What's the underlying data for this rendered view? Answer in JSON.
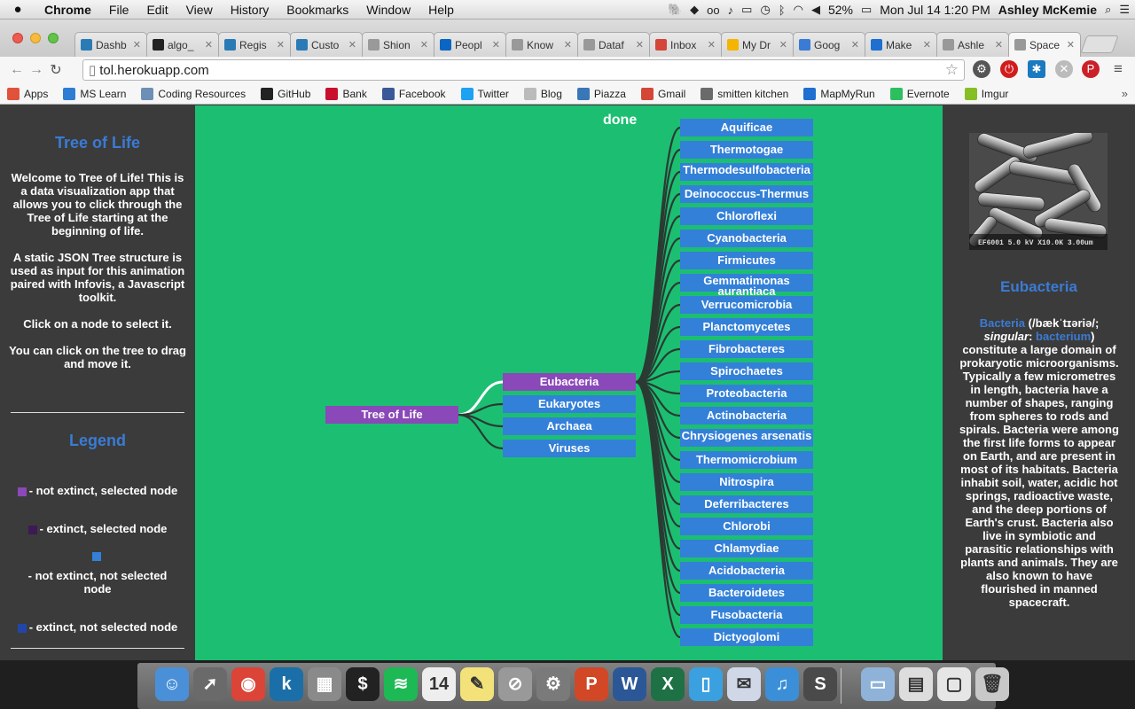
{
  "menubar": {
    "apple_icon": "apple-logo-icon",
    "app_name": "Chrome",
    "items": [
      "File",
      "Edit",
      "View",
      "History",
      "Bookmarks",
      "Window",
      "Help"
    ],
    "battery": "52%",
    "clock": "Mon Jul 14  1:20 PM",
    "user": "Ashley McKemie"
  },
  "tabs": [
    {
      "label": "Dashb",
      "icon": "wordpress-icon",
      "color": "#2a7bb5"
    },
    {
      "label": "algo_",
      "icon": "github-icon",
      "color": "#222222"
    },
    {
      "label": "Regis",
      "icon": "wordpress-icon",
      "color": "#2a7bb5"
    },
    {
      "label": "Custo",
      "icon": "wordpress-icon",
      "color": "#2a7bb5"
    },
    {
      "label": "Shion",
      "icon": "page-icon",
      "color": "#999999"
    },
    {
      "label": "Peopl",
      "icon": "linkedin-icon",
      "color": "#0a66c2"
    },
    {
      "label": "Know",
      "icon": "page-icon",
      "color": "#999999"
    },
    {
      "label": "Dataf",
      "icon": "page-icon",
      "color": "#999999"
    },
    {
      "label": "Inbox",
      "icon": "gmail-icon",
      "color": "#d44638"
    },
    {
      "label": "My Dr",
      "icon": "drive-icon",
      "color": "#f4b400"
    },
    {
      "label": "Goog",
      "icon": "calendar-icon",
      "color": "#3a7bd5"
    },
    {
      "label": "Make",
      "icon": "mapmyrun-icon",
      "color": "#1e6fd0"
    },
    {
      "label": "Ashle",
      "icon": "page-icon",
      "color": "#999999"
    },
    {
      "label": "Space",
      "icon": "page-icon",
      "color": "#999999",
      "active": true
    }
  ],
  "address": {
    "url": "tol.herokuapp.com"
  },
  "bookmarks": [
    {
      "label": "Apps",
      "color": "#e0533a"
    },
    {
      "label": "MS Learn",
      "color": "#2d7dd2"
    },
    {
      "label": "Coding Resources",
      "color": "#6d8fb5"
    },
    {
      "label": "GitHub",
      "color": "#222222"
    },
    {
      "label": "Bank",
      "color": "#c8102e"
    },
    {
      "label": "Facebook",
      "color": "#3b5998"
    },
    {
      "label": "Twitter",
      "color": "#1da1f2"
    },
    {
      "label": "Blog",
      "color": "#bbbbbb"
    },
    {
      "label": "Piazza",
      "color": "#3a77b8"
    },
    {
      "label": "Gmail",
      "color": "#d44638"
    },
    {
      "label": "smitten kitchen",
      "color": "#6a6a6a"
    },
    {
      "label": "MapMyRun",
      "color": "#1e6fd0"
    },
    {
      "label": "Evernote",
      "color": "#2dbe60"
    },
    {
      "label": "Imgur",
      "color": "#85bf25"
    }
  ],
  "left_panel": {
    "title": "Tree of Life",
    "intro": "Welcome to Tree of Life! This is a data visualization app that allows you to click through the Tree of Life starting at the beginning of life.",
    "json_note": "A static JSON Tree structure is used as input for this animation paired with Infovis, a Javascript toolkit.",
    "click_note": "Click on a node to select it.",
    "drag_note": "You can click on the tree to drag and move it.",
    "legend_title": "Legend",
    "legend": [
      {
        "label": "- not extinct, selected node",
        "color": "#8a48b8"
      },
      {
        "label": "- extinct, selected node",
        "color": "#3d1a55"
      },
      {
        "label": "- not extinct, not selected node",
        "color": "#3380d8"
      },
      {
        "label": "- extinct, not selected node",
        "color": "#2146a8"
      }
    ]
  },
  "viz": {
    "status": "done",
    "root": "Tree of Life",
    "level1": [
      {
        "label": "Eubacteria",
        "selected": true
      },
      {
        "label": "Eukaryotes",
        "selected": false
      },
      {
        "label": "Archaea",
        "selected": false
      },
      {
        "label": "Viruses",
        "selected": false
      }
    ],
    "level2": [
      "Aquificae",
      "Thermotogae",
      "Thermodesulfobacteria",
      "Deinococcus-Thermus",
      "Chloroflexi",
      "Cyanobacteria",
      "Firmicutes",
      "Gemmatimonas aurantiaca",
      "Verrucomicrobia",
      "Planctomycetes",
      "Fibrobacteres",
      "Spirochaetes",
      "Proteobacteria",
      "Actinobacteria",
      "Chrysiogenes arsenatis",
      "Thermomicrobium",
      "Nitrospira",
      "Deferribacteres",
      "Chlorobi",
      "Chlamydiae",
      "Acidobacteria",
      "Bacteroidetes",
      "Fusobacteria",
      "Dictyoglomi"
    ],
    "colors": {
      "bg": "#1cbf72",
      "node": "#3380d8",
      "selected": "#8a48b8",
      "edge": "#2b3a33",
      "selected_edge": "#ffffff"
    }
  },
  "right_panel": {
    "image_caption": "EF6001 5.0 kV X10.0K 3.00um",
    "heading": "Eubacteria",
    "desc_link1": "Bacteria",
    "desc_pron": " (/bækˈtɪəriə/; ",
    "desc_singular": "singular",
    "desc_colon": ": ",
    "desc_link2": "bacterium",
    "desc_body": ") constitute a large domain of prokaryotic microorganisms. Typically a few micrometres in length, bacteria have a number of shapes, ranging from spheres to rods and spirals. Bacteria were among the first life forms to appear on Earth, and are present in most of its habitats. Bacteria inhabit soil, water, acidic hot springs, radioactive waste, and the deep portions of Earth's crust. Bacteria also live in symbiotic and parasitic relationships with plants and animals. They are also known to have flourished in manned spacecraft."
  },
  "dock": [
    {
      "name": "finder-icon",
      "color": "#4a90d9",
      "glyph": "☺"
    },
    {
      "name": "launchpad-icon",
      "color": "#6a6a6a",
      "glyph": "➚"
    },
    {
      "name": "chrome-icon",
      "color": "#db4437",
      "glyph": "◉"
    },
    {
      "name": "kindle-icon",
      "color": "#1b6fa8",
      "glyph": "k"
    },
    {
      "name": "calculator-icon",
      "color": "#8a8a8a",
      "glyph": "▦"
    },
    {
      "name": "terminal-icon",
      "color": "#222222",
      "glyph": "$"
    },
    {
      "name": "spotify-icon",
      "color": "#1db954",
      "glyph": "≋"
    },
    {
      "name": "calendar-icon",
      "color": "#eeeeee",
      "glyph": "14"
    },
    {
      "name": "stickies-icon",
      "color": "#f3e27a",
      "glyph": "✎"
    },
    {
      "name": "no-entry-icon",
      "color": "#999999",
      "glyph": "⊘"
    },
    {
      "name": "system-preferences-icon",
      "color": "#7a7a7a",
      "glyph": "⚙"
    },
    {
      "name": "powerpoint-icon",
      "color": "#d24726",
      "glyph": "P"
    },
    {
      "name": "word-icon",
      "color": "#2b5797",
      "glyph": "W"
    },
    {
      "name": "excel-icon",
      "color": "#1e7145",
      "glyph": "X"
    },
    {
      "name": "simulator-icon",
      "color": "#3aa0e0",
      "glyph": "▯"
    },
    {
      "name": "preview-icon",
      "color": "#d0d8e8",
      "glyph": "✉"
    },
    {
      "name": "itunes-icon",
      "color": "#3a8fd8",
      "glyph": "♫"
    },
    {
      "name": "sublime-text-icon",
      "color": "#4a4a4a",
      "glyph": "S"
    },
    {
      "name": "folder-icon",
      "color": "#8fb2d8",
      "glyph": "▭"
    },
    {
      "name": "pdf-document-icon",
      "color": "#dddddd",
      "glyph": "▤"
    },
    {
      "name": "chrome-window-icon",
      "color": "#e6e6e6",
      "glyph": "▢"
    },
    {
      "name": "trash-icon",
      "color": "#c8c8c8",
      "glyph": "🗑"
    }
  ]
}
